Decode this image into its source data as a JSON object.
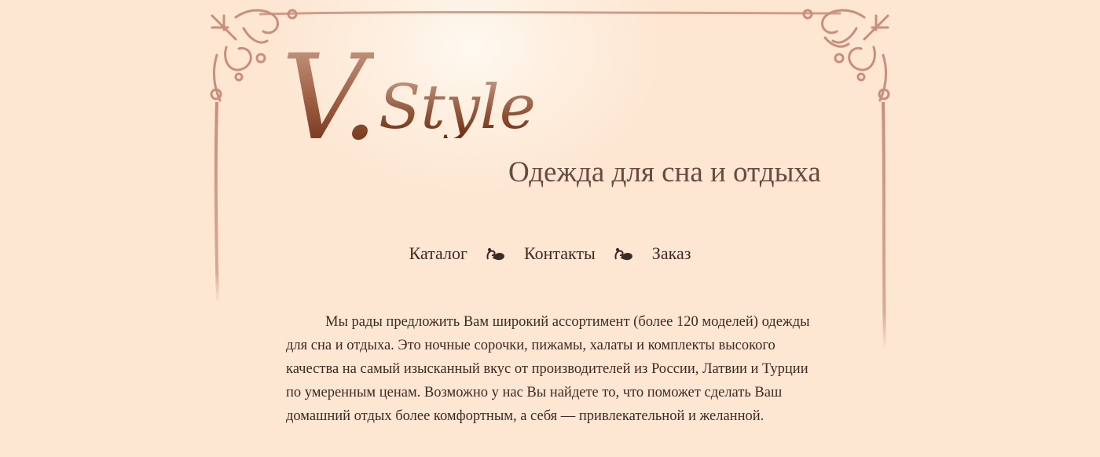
{
  "brand": {
    "logo_letter": "V.",
    "logo_word": "Style",
    "tagline": "Одежда для сна и отдыха"
  },
  "nav": {
    "items": [
      {
        "label": "Каталог"
      },
      {
        "label": "Контакты"
      },
      {
        "label": "Заказ"
      }
    ],
    "separator_icon": "ornament-icon"
  },
  "intro": {
    "text": "Мы рады предложить Вам широкий ассортимент (более 120 моделей) одежды для сна и отдыха. Это ночные сорочки, пижамы, халаты и комплекты высокого качества на самый изысканный вкус от производителей из России, Латвии и Турции по умеренным ценам. Возможно у нас Вы найдете то, что поможет сделать Ваш домашний отдых более комфортным, а себя — привлекательной и желанной."
  },
  "colors": {
    "background": "#fde6d2",
    "frame": "#c98e7c",
    "text": "#3c2a25",
    "tagline": "#6a4a40",
    "logo_dark": "#6b2e14"
  }
}
